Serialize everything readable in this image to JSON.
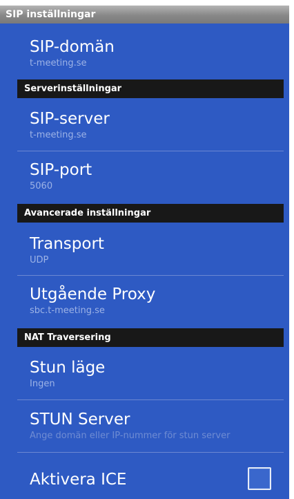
{
  "window": {
    "title": "SIP inställningar"
  },
  "preferences": [
    {
      "title": "SIP-domän",
      "summary": "t-meeting.se"
    },
    {
      "category": "Serverinställningar"
    },
    {
      "title": "SIP-server",
      "summary": "t-meeting.se"
    },
    {
      "title": "SIP-port",
      "summary": "5060"
    },
    {
      "category": "Avancerade inställningar"
    },
    {
      "title": "Transport",
      "summary": "UDP"
    },
    {
      "title": "Utgående Proxy",
      "summary": "sbc.t-meeting.se"
    },
    {
      "category": "NAT Traversering"
    },
    {
      "title": "Stun läge",
      "summary": "Ingen"
    },
    {
      "title": "STUN Server",
      "summary": "Ange domän eller IP-nummer för stun server"
    },
    {
      "title": "Aktivera ICE",
      "checked": false
    }
  ]
}
